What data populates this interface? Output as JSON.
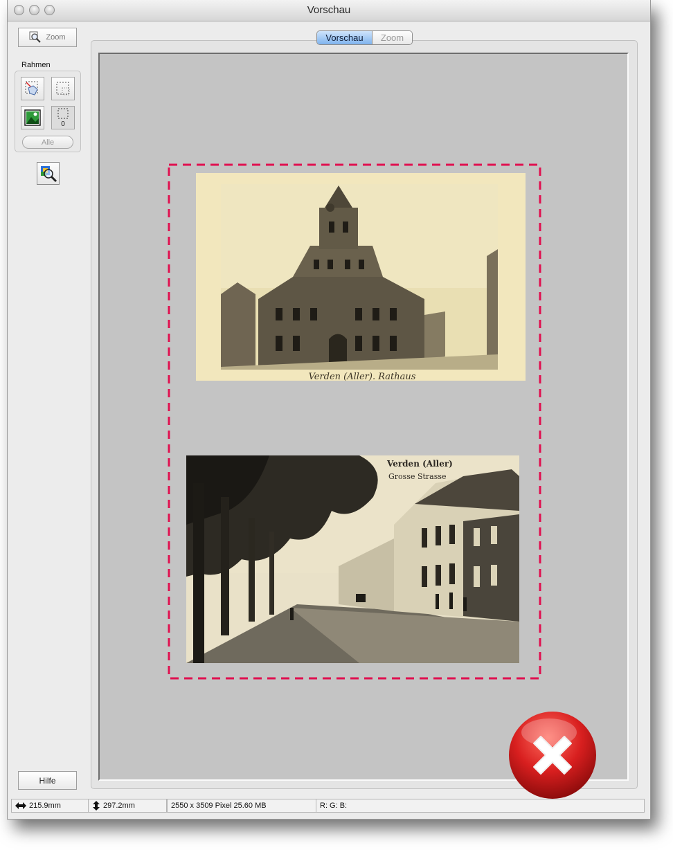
{
  "window": {
    "title": "Vorschau"
  },
  "toolbar": {
    "zoom_button_label": "Zoom"
  },
  "frame_group": {
    "label": "Rahmen",
    "frame_count": "0",
    "select_all_label": "Alle"
  },
  "view_toggle": {
    "options": [
      "Vorschau",
      "Zoom"
    ],
    "selected": "Vorschau"
  },
  "preview": {
    "photo1_caption": "Verden (Aller). Rathaus",
    "photo2_title": "Verden (Aller)",
    "photo2_subtitle": "Grosse Strasse"
  },
  "help_button_label": "Hilfe",
  "status": {
    "width": "215.9mm",
    "height": "297.2mm",
    "pixel_info": "2550 x 3509 Pixel 25.60 MB",
    "rgb": "R: G: B:"
  },
  "colors": {
    "marquee": "#e0104f",
    "preview_background": "#c4c4c4",
    "close_badge": "#d81f1f"
  },
  "icons": {
    "zoom": "magnifier-icon",
    "frame_select": "marquee-select-icon",
    "frame_clear": "marquee-icon",
    "thumbnail": "thumbnail-image-icon",
    "frame_count": "frame-count-icon",
    "auto_zoom": "auto-zoom-icon",
    "close_badge": "error-x-icon",
    "width_arrow": "horizontal-arrow-icon",
    "height_arrow": "vertical-arrow-icon"
  }
}
